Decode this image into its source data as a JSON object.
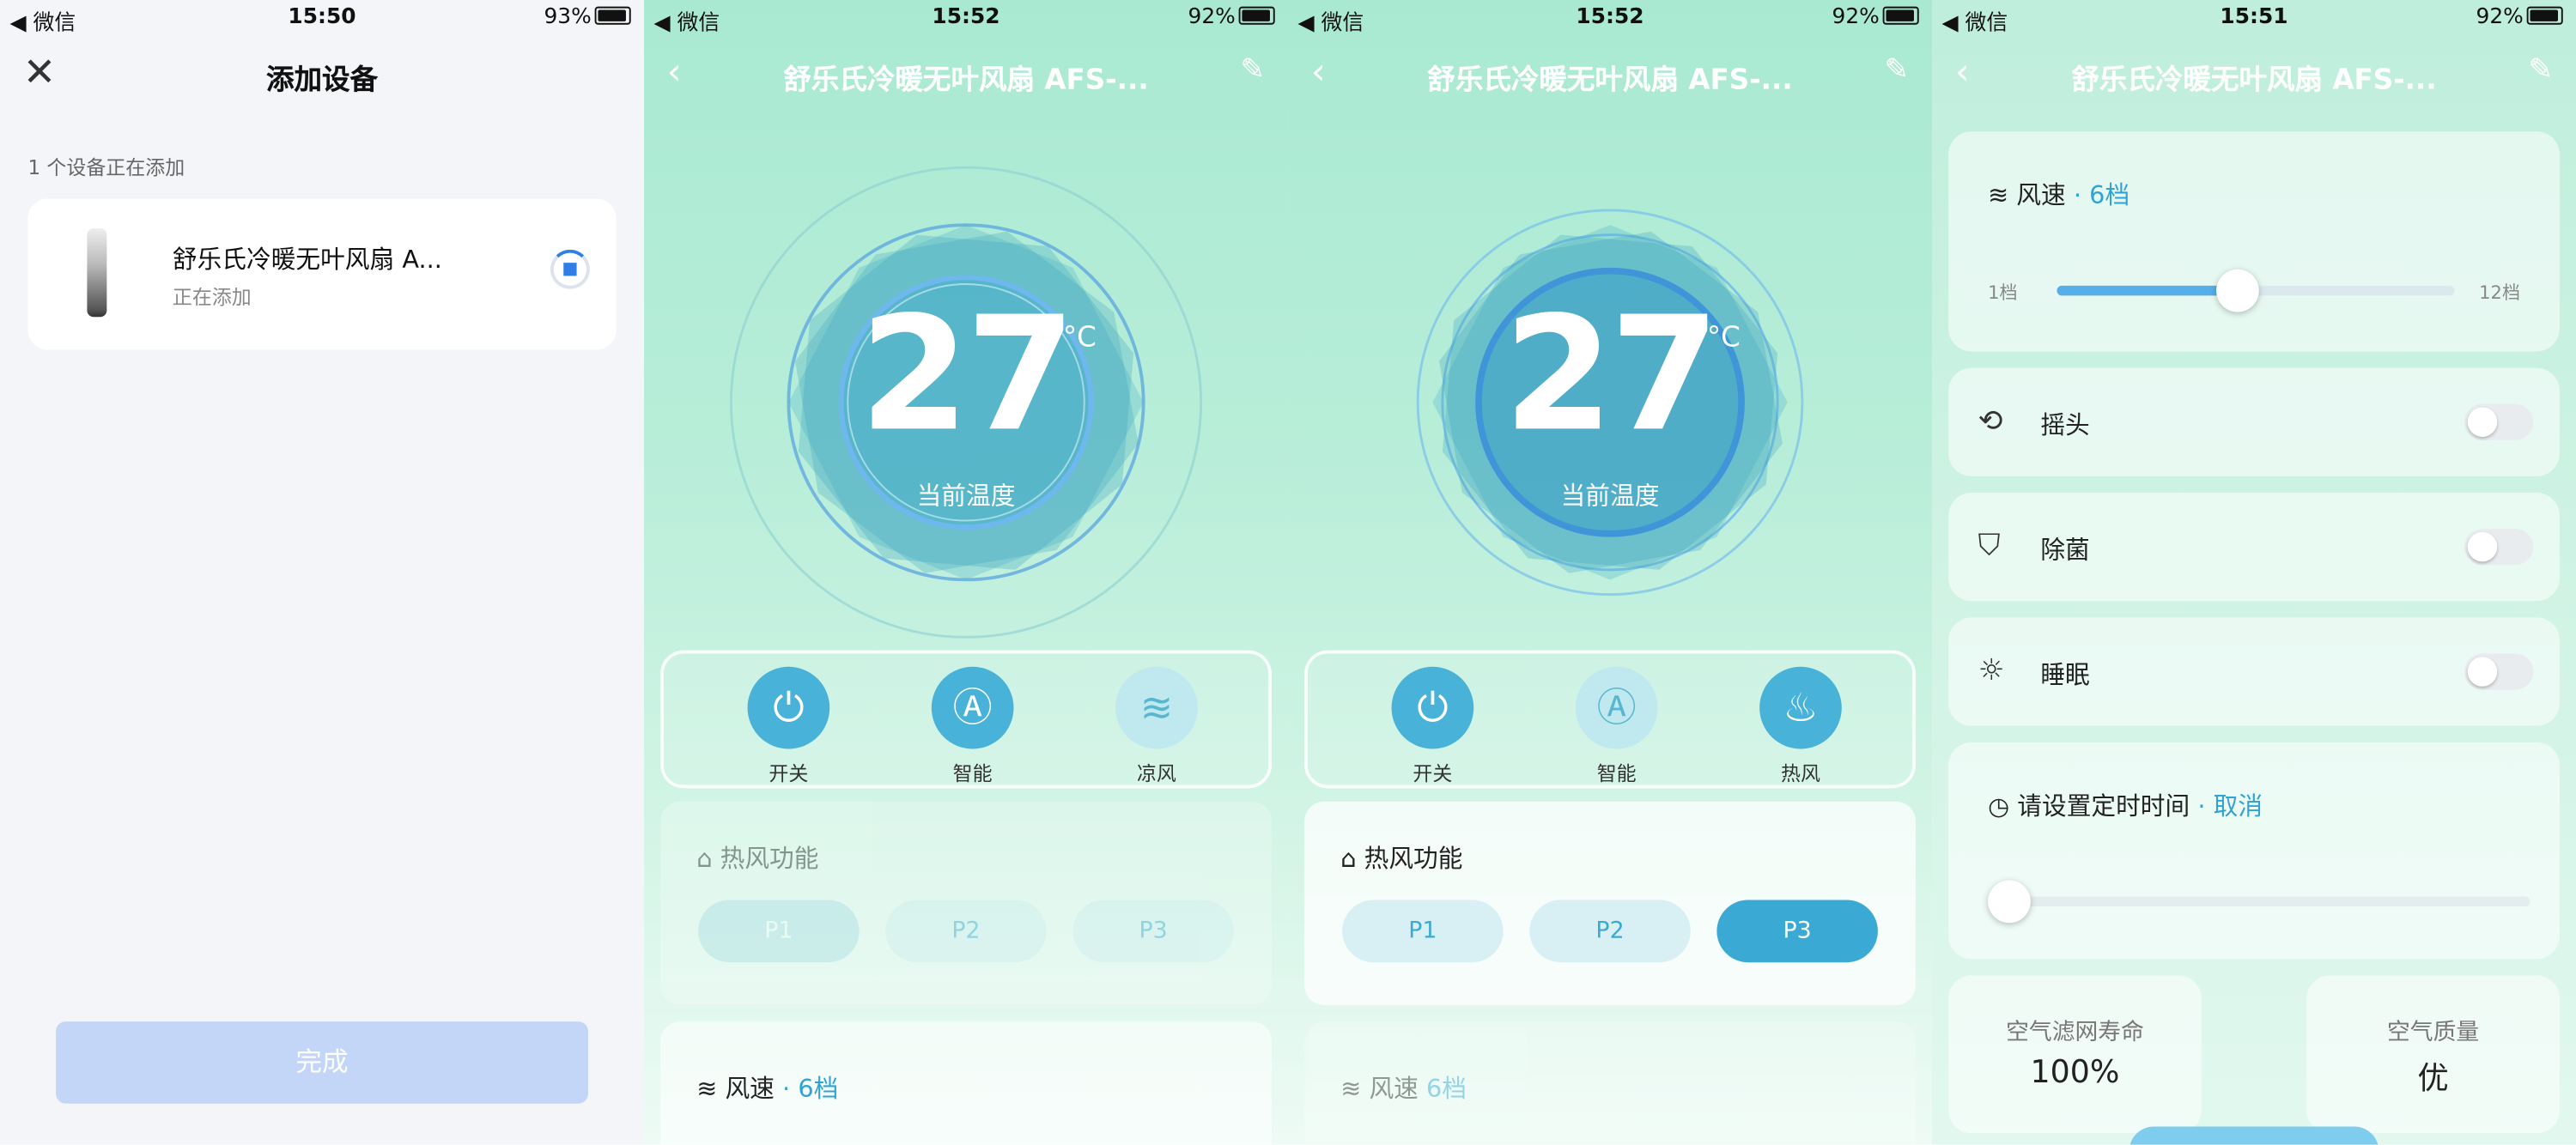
{
  "status": {
    "carrier": "◀ 微信",
    "phone1_time": "15:50",
    "phone1_battery": "93%",
    "phone2_time": "15:52",
    "phone3_time": "15:52",
    "phone4_time": "15:51",
    "battery": "92%"
  },
  "add_device": {
    "title": "添加设备",
    "subtitle": "1 个设备正在添加",
    "device_name": "舒乐氏冷暖无叶风扇 A...",
    "device_status": "正在添加",
    "done_label": "完成"
  },
  "device": {
    "title": "舒乐氏冷暖无叶风扇 AFS-...",
    "temperature": "27",
    "unit": "°C",
    "temp_label": "当前温度",
    "power_label": "开关",
    "smart_label": "智能",
    "cool_label": "凉风",
    "heat_label": "热风",
    "heat_title": "热风功能",
    "p1": "P1",
    "p2": "P2",
    "p3": "P3",
    "wind_title": "风速",
    "wind_level": "6档",
    "wind_min": "1档",
    "wind_max": "12档",
    "wind_fraction": 0.4545,
    "dot": "·",
    "swing_label": "摇头",
    "sterilize_label": "除菌",
    "sleep_label": "睡眠",
    "timer_label": "请设置定时时间",
    "timer_cancel": "取消",
    "filter_label": "空气滤网寿命",
    "filter_value": "100%",
    "air_label": "空气质量",
    "air_value": "优"
  },
  "colors": {
    "accent": "#3aa9d4",
    "mint_top": "#a9e9d2",
    "button_disabled": "#c4d6f8"
  }
}
